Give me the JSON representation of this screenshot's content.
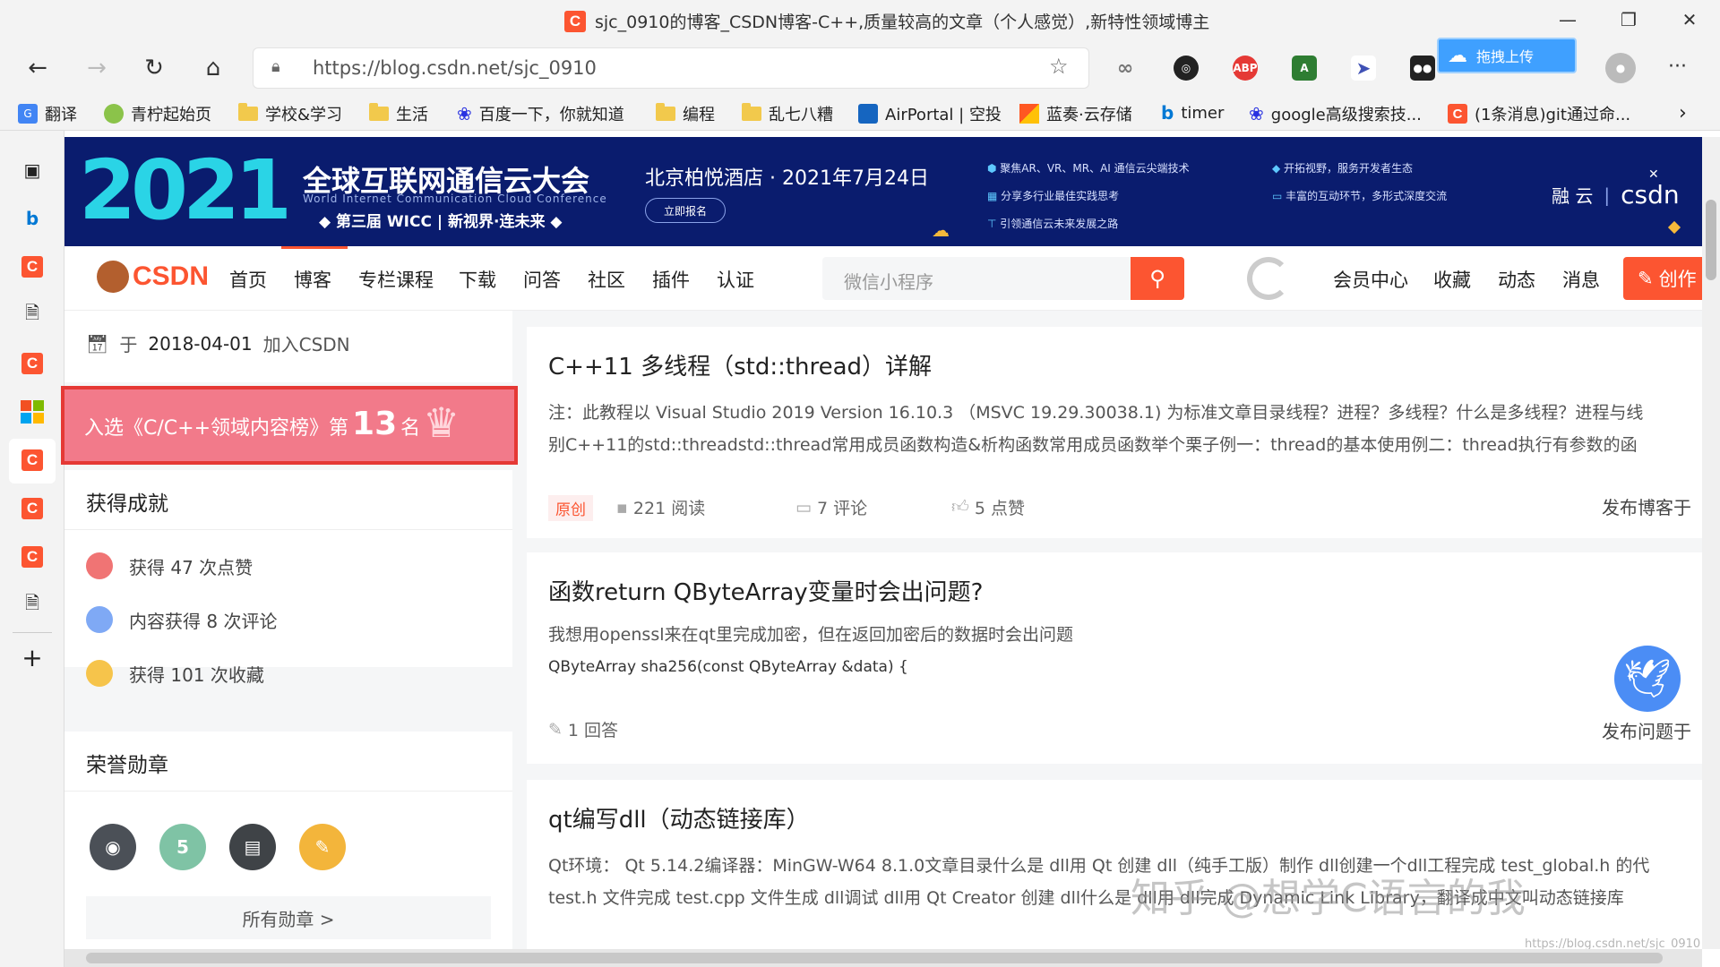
{
  "window": {
    "title": "sjc_0910的博客_CSDN博客-C++,质量较高的文章（个人感觉）,新特性领域博主",
    "minimize": "—",
    "restore": "❐",
    "close": "✕"
  },
  "browser": {
    "url": "https://blog.csdn.net/sjc_0910",
    "upload_label": "拖拽上传",
    "more": "···"
  },
  "bookmarks": [
    {
      "label": "翻译",
      "icon": "translate-icon"
    },
    {
      "label": "青柠起始页",
      "icon": "lemon-icon"
    },
    {
      "label": "学校&学习",
      "icon": "folder-icon"
    },
    {
      "label": "生活",
      "icon": "folder-icon"
    },
    {
      "label": "百度一下，你就知道",
      "icon": "baidu-icon"
    },
    {
      "label": "编程",
      "icon": "folder-icon"
    },
    {
      "label": "乱七八糟",
      "icon": "folder-icon"
    },
    {
      "label": "AirPortal | 空投",
      "icon": "airportal-icon"
    },
    {
      "label": "蓝奏·云存储",
      "icon": "lanzou-icon"
    },
    {
      "label": "timer",
      "icon": "bing-icon"
    },
    {
      "label": "google高级搜索技...",
      "icon": "baidu-icon"
    },
    {
      "label": "(1条消息)git通过命...",
      "icon": "csdn-icon"
    }
  ],
  "banner": {
    "year": "2021",
    "title": "全球互联网通信云大会",
    "subtitle_en": "World Internet Communication Cloud Conference",
    "tagline": "◆ 第三届 WICC | 新视界·连未来 ◆",
    "location": "北京柏悦酒店 · 2021年7月24日",
    "register": "立即报名",
    "points_a": [
      "聚焦AR、VR、MR、AI 通信云尖端技术",
      "分享多行业最佳实践思考",
      "引领通信云未来发展之路"
    ],
    "points_b": [
      "开拓视野，服务开发者生态",
      "丰富的互动环节，多形式深度交流"
    ],
    "brand_a": "融 云",
    "brand_b": "csdn",
    "close": "✕"
  },
  "nav": {
    "logo": "CSDN",
    "links": [
      "首页",
      "博客",
      "专栏课程",
      "下载",
      "问答",
      "社区",
      "插件",
      "认证"
    ],
    "search_placeholder": "微信小程序",
    "right_links": [
      "会员中心",
      "收藏",
      "动态",
      "消息"
    ],
    "create": "创作"
  },
  "profile": {
    "join_prefix": "于",
    "join_date": "2018-04-01",
    "join_suffix": "加入CSDN",
    "rank_prefix": "入选《C/C++领域内容榜》第",
    "rank_num": "13",
    "rank_suffix": "名"
  },
  "achievements": {
    "title": "获得成就",
    "items": [
      {
        "text": "获得 47 次点赞",
        "color": "#f07474"
      },
      {
        "text": "内容获得 8 次评论",
        "color": "#7fa9f5"
      },
      {
        "text": "获得 101 次收藏",
        "color": "#f6c44b"
      }
    ]
  },
  "medals": {
    "title": "荣誉勋章",
    "all": "所有勋章 >",
    "items": [
      {
        "icon": "github-medal-icon",
        "glyph": "◉",
        "color": "#4b5057"
      },
      {
        "icon": "five-year-medal-icon",
        "glyph": "5",
        "color": "#7fc3a5"
      },
      {
        "icon": "blog-medal-icon",
        "glyph": "▤",
        "color": "#3f4347"
      },
      {
        "icon": "pen-medal-icon",
        "glyph": "✎",
        "color": "#f3b53b"
      }
    ]
  },
  "articles": [
    {
      "title": "C++11 多线程（std::thread）详解",
      "body1": "注：此教程以 Visual Studio 2019 Version 16.10.3 （MSVC 19.29.30038.1) 为标准文章目录线程？进程？多线程？什么是多线程？进程与线",
      "body2": "别C++11的std::threadstd::thread常用成员函数构造&析构函数常用成员函数举个栗子例一：thread的基本使用例二：thread执行有参数的函",
      "tag": "原创",
      "reads": "221 阅读",
      "comments": "7 评论",
      "likes": "5 点赞",
      "publish": "发布博客于"
    },
    {
      "title": "函数return QByteArray变量时会出问题?",
      "body1": "我想用openssl来在qt里完成加密，但在返回加密后的数据时会出问题",
      "body2": "QByteArray sha256(const QByteArray &data) {",
      "answers": "1 回答",
      "publish": "发布问题于"
    },
    {
      "title": "qt编写dll（动态链接库）",
      "body1": "Qt环境：  Qt 5.14.2编译器：MinGW-W64 8.1.0文章目录什么是 dll用 Qt 创建 dll（纯手工版）制作 dll创建一个dll工程完成 test_global.h 的代",
      "body2": "test.h 文件完成 test.cpp 文件生成 dll调试 dll用 Qt Creator 创建 dll什么是 dll用 dll完成 Dynamic Link Library，翻译成中文叫动态链接库"
    }
  ],
  "watermark": "知乎 @想学C语言的我",
  "watermark_url": "https://blog.csdn.net/sjc_0910"
}
